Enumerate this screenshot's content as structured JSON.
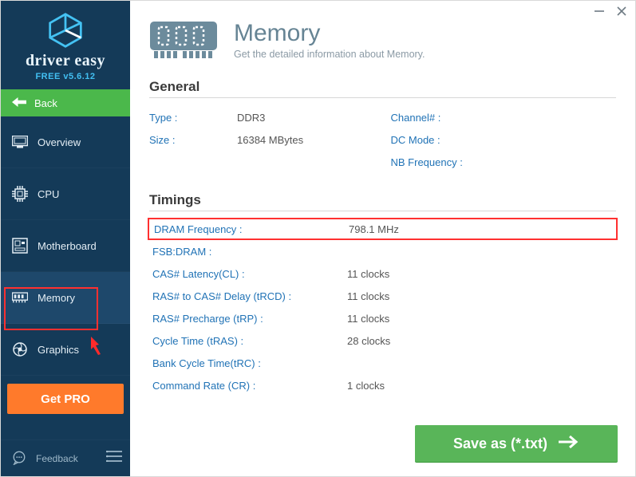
{
  "branding": {
    "name": "driver easy",
    "version": "FREE v5.6.12"
  },
  "sidebar": {
    "back": "Back",
    "items": [
      {
        "label": "Overview"
      },
      {
        "label": "CPU"
      },
      {
        "label": "Motherboard"
      },
      {
        "label": "Memory"
      },
      {
        "label": "Graphics"
      }
    ],
    "get_pro": "Get PRO",
    "feedback": "Feedback"
  },
  "page": {
    "title": "Memory",
    "subtitle": "Get the detailed information about Memory."
  },
  "sections": {
    "general_title": "General",
    "timings_title": "Timings"
  },
  "general": {
    "left": [
      {
        "label": "Type :",
        "value": "DDR3"
      },
      {
        "label": "Size :",
        "value": "16384 MBytes"
      }
    ],
    "right": [
      {
        "label": "Channel# :",
        "value": ""
      },
      {
        "label": "DC Mode :",
        "value": ""
      },
      {
        "label": "NB Frequency :",
        "value": ""
      }
    ]
  },
  "timings": [
    {
      "label": "DRAM Frequency :",
      "value": "798.1 MHz",
      "highlight": true
    },
    {
      "label": "FSB:DRAM :",
      "value": ""
    },
    {
      "label": "CAS# Latency(CL) :",
      "value": "11 clocks"
    },
    {
      "label": "RAS# to CAS# Delay (tRCD) :",
      "value": "11 clocks"
    },
    {
      "label": "RAS# Precharge (tRP) :",
      "value": "11 clocks"
    },
    {
      "label": "Cycle Time (tRAS) :",
      "value": "28 clocks"
    },
    {
      "label": "Bank Cycle Time(tRC) :",
      "value": ""
    },
    {
      "label": "Command Rate (CR) :",
      "value": "1 clocks"
    }
  ],
  "save_button": "Save as (*.txt)"
}
